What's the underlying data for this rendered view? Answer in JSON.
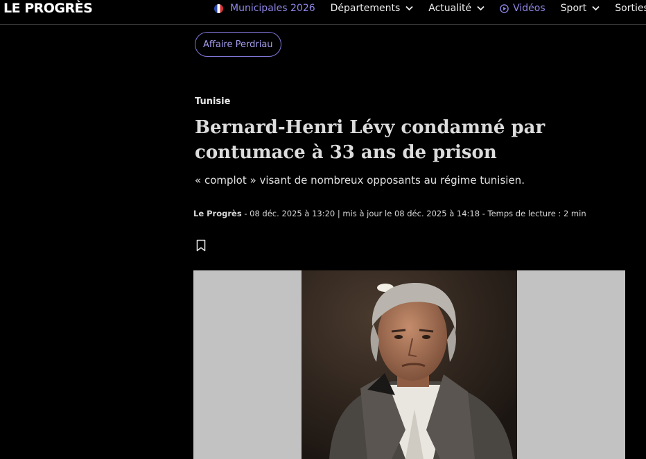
{
  "site": {
    "logo": "LE PROGRÈS"
  },
  "nav": {
    "items": [
      {
        "label": "Municipales 2026",
        "icon": "flag-fr-icon",
        "accent": true
      },
      {
        "label": "Départements",
        "icon": "chevron-down-icon"
      },
      {
        "label": "Actualité",
        "icon": "chevron-down-icon"
      },
      {
        "label": "Vidéos",
        "icon": "play-icon",
        "accent": true
      },
      {
        "label": "Sport",
        "icon": "chevron-down-icon"
      },
      {
        "label": "Sorties"
      }
    ]
  },
  "article": {
    "tag": "Affaire Perdriau",
    "rubric": "Tunisie",
    "title": "Bernard-Henri Lévy condamné par contumace à 33 ans de prison",
    "lede": "« complot » visant de nombreux opposants au régime tunisien.",
    "meta": {
      "source": "Le Progrès",
      "rest": " - 08 déc. 2025 à 13:20 | mis à jour le 08 déc. 2025 à 14:18 - Temps de lecture : 2 min"
    },
    "bookmark_icon": "bookmark-icon"
  },
  "colors": {
    "background": "#000000",
    "accent": "#8f86e8",
    "media_bg": "#c2c2c2"
  }
}
